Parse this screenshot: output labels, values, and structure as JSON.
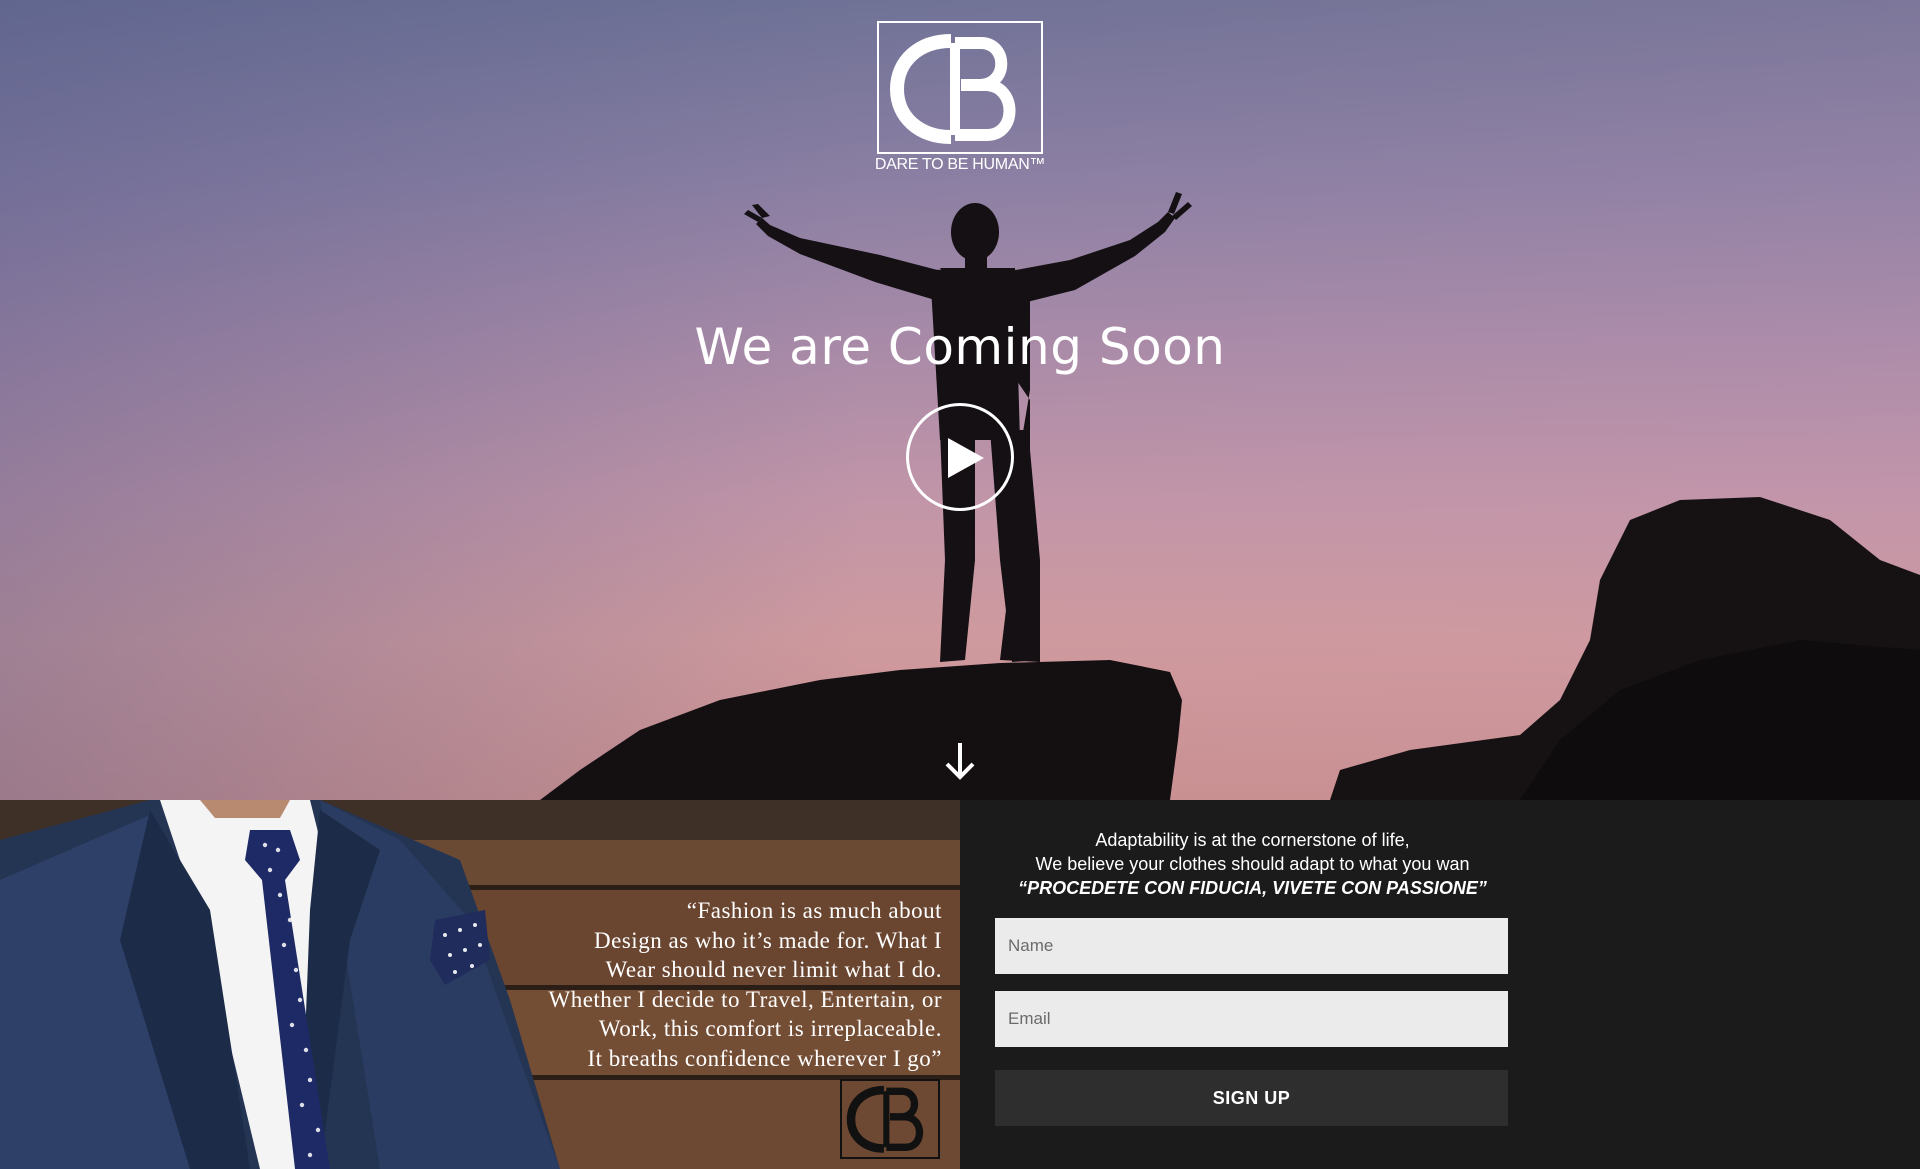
{
  "brand": {
    "logo_text": "CB",
    "tagline": "DARE TO BE HUMAN™"
  },
  "hero": {
    "headline": "We are Coming Soon",
    "play_icon": "play-circle-icon",
    "scroll_icon": "arrow-down-icon"
  },
  "promo": {
    "quote_lines": [
      "“Fashion is as much about",
      "Design as who it’s made for. What I",
      "Wear should never limit what I do.",
      "Whether I decide to Travel, Entertain, or",
      "Work, this comfort is irreplaceable.",
      "It breaths confidence wherever I go”"
    ]
  },
  "signup": {
    "intro_line_1": "Adaptability is at the cornerstone of life,",
    "intro_line_2": "We believe your clothes should adapt to what you wan",
    "motto": "“PROCEDETE CON FIDUCIA, VIVETE CON PASSIONE”",
    "name_placeholder": "Name",
    "email_placeholder": "Email",
    "button_label": "SIGN UP"
  },
  "colors": {
    "sky_top": "#6f7296",
    "sky_bottom": "#cf9a9e",
    "panel_bg": "#1b1b1b",
    "button_bg": "#2e2e2e",
    "field_bg": "#ebebeb"
  }
}
